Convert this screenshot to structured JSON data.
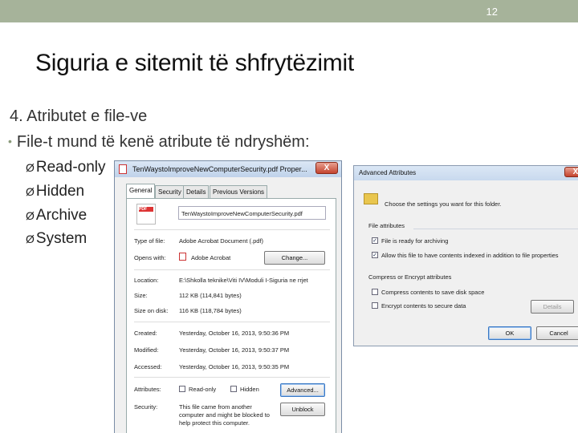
{
  "slide": {
    "number": "12",
    "title": "Siguria e sitemit të shfrytëzimit",
    "point": "4. Atributet e file-ve",
    "bullet": "File-t mund të kenë atribute të ndryshëm:",
    "attributes": [
      "Read-only",
      "Hidden",
      "Archive",
      "System"
    ]
  },
  "properties_dialog": {
    "title": "TenWaystoImproveNewComputerSecurity.pdf Proper...",
    "close": "X",
    "tabs": [
      "General",
      "Security",
      "Details",
      "Previous Versions"
    ],
    "filename": "TenWaystoImproveNewComputerSecurity.pdf",
    "rows": {
      "type_label": "Type of file:",
      "type_value": "Adobe Acrobat Document (.pdf)",
      "opens_label": "Opens with:",
      "opens_value": "Adobe Acrobat",
      "change_button": "Change...",
      "location_label": "Location:",
      "location_value": "E:\\Shkolla teknike\\Viti IV\\Moduli I-Siguria ne rrjet",
      "size_label": "Size:",
      "size_value": "112 KB (114,841 bytes)",
      "disk_label": "Size on disk:",
      "disk_value": "116 KB (118,784 bytes)",
      "created_label": "Created:",
      "created_value": "Yesterday, October 16, 2013, 9:50:36 PM",
      "modified_label": "Modified:",
      "modified_value": "Yesterday, October 16, 2013, 9:50:37 PM",
      "accessed_label": "Accessed:",
      "accessed_value": "Yesterday, October 16, 2013, 9:50:35 PM",
      "attributes_label": "Attributes:",
      "readonly": "Read-only",
      "hidden": "Hidden",
      "advanced_button": "Advanced...",
      "security_label": "Security:",
      "security_text_1": "This file came from another",
      "security_text_2": "computer and might be blocked to",
      "security_text_3": "help protect this computer.",
      "unblock_button": "Unblock"
    }
  },
  "advanced_dialog": {
    "title": "Advanced Attributes",
    "close": "X",
    "intro": "Choose the settings you want for this folder.",
    "file_attributes": "File attributes",
    "archive_option": "File is ready for archiving",
    "index_option": "Allow this file to have contents indexed in addition to file properties",
    "compress_group": "Compress or Encrypt attributes",
    "compress_option": "Compress contents to save disk space",
    "encrypt_option": "Encrypt contents to secure data",
    "details_button": "Details",
    "ok_button": "OK",
    "cancel_button": "Cancel"
  }
}
